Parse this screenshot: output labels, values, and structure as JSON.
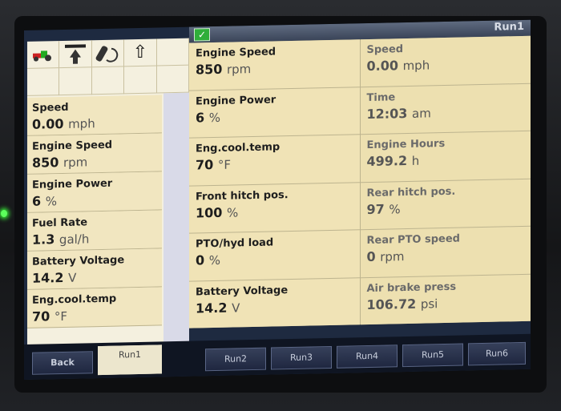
{
  "window": {
    "title": "Run1"
  },
  "left_panel": {
    "fields": [
      {
        "label": "Speed",
        "value": "0.00",
        "unit": "mph"
      },
      {
        "label": "Engine Speed",
        "value": "850",
        "unit": "rpm"
      },
      {
        "label": "Engine Power",
        "value": "6",
        "unit": "%"
      },
      {
        "label": "Fuel Rate",
        "value": "1.3",
        "unit": "gal/h"
      },
      {
        "label": "Battery Voltage",
        "value": "14.2",
        "unit": "V"
      },
      {
        "label": "Eng.cool.temp",
        "value": "70",
        "unit": "°F"
      }
    ]
  },
  "grid": {
    "left": [
      {
        "label": "Engine Speed",
        "value": "850",
        "unit": "rpm"
      },
      {
        "label": "Engine Power",
        "value": "6",
        "unit": "%"
      },
      {
        "label": "Eng.cool.temp",
        "value": "70",
        "unit": "°F"
      },
      {
        "label": "Front hitch pos.",
        "value": "100",
        "unit": "%"
      },
      {
        "label": "PTO/hyd load",
        "value": "0",
        "unit": "%"
      },
      {
        "label": "Battery Voltage",
        "value": "14.2",
        "unit": "V"
      }
    ],
    "right": [
      {
        "label": "Speed",
        "value": "0.00",
        "unit": "mph"
      },
      {
        "label": "Time",
        "value": "12:03",
        "unit": "am"
      },
      {
        "label": "Engine Hours",
        "value": "499.2",
        "unit": "h"
      },
      {
        "label": "Rear hitch pos.",
        "value": "97",
        "unit": "%"
      },
      {
        "label": "Rear PTO speed",
        "value": "0",
        "unit": "rpm"
      },
      {
        "label": "Air brake press",
        "value": "106.72",
        "unit": "psi"
      }
    ]
  },
  "tabs": {
    "back": "Back",
    "items": [
      "Run1",
      "Run2",
      "Run3",
      "Run4",
      "Run5",
      "Run6"
    ]
  },
  "colors": {
    "panel": "#f0e3b6",
    "banner": "#3a4458",
    "led": "#5cff5c"
  }
}
